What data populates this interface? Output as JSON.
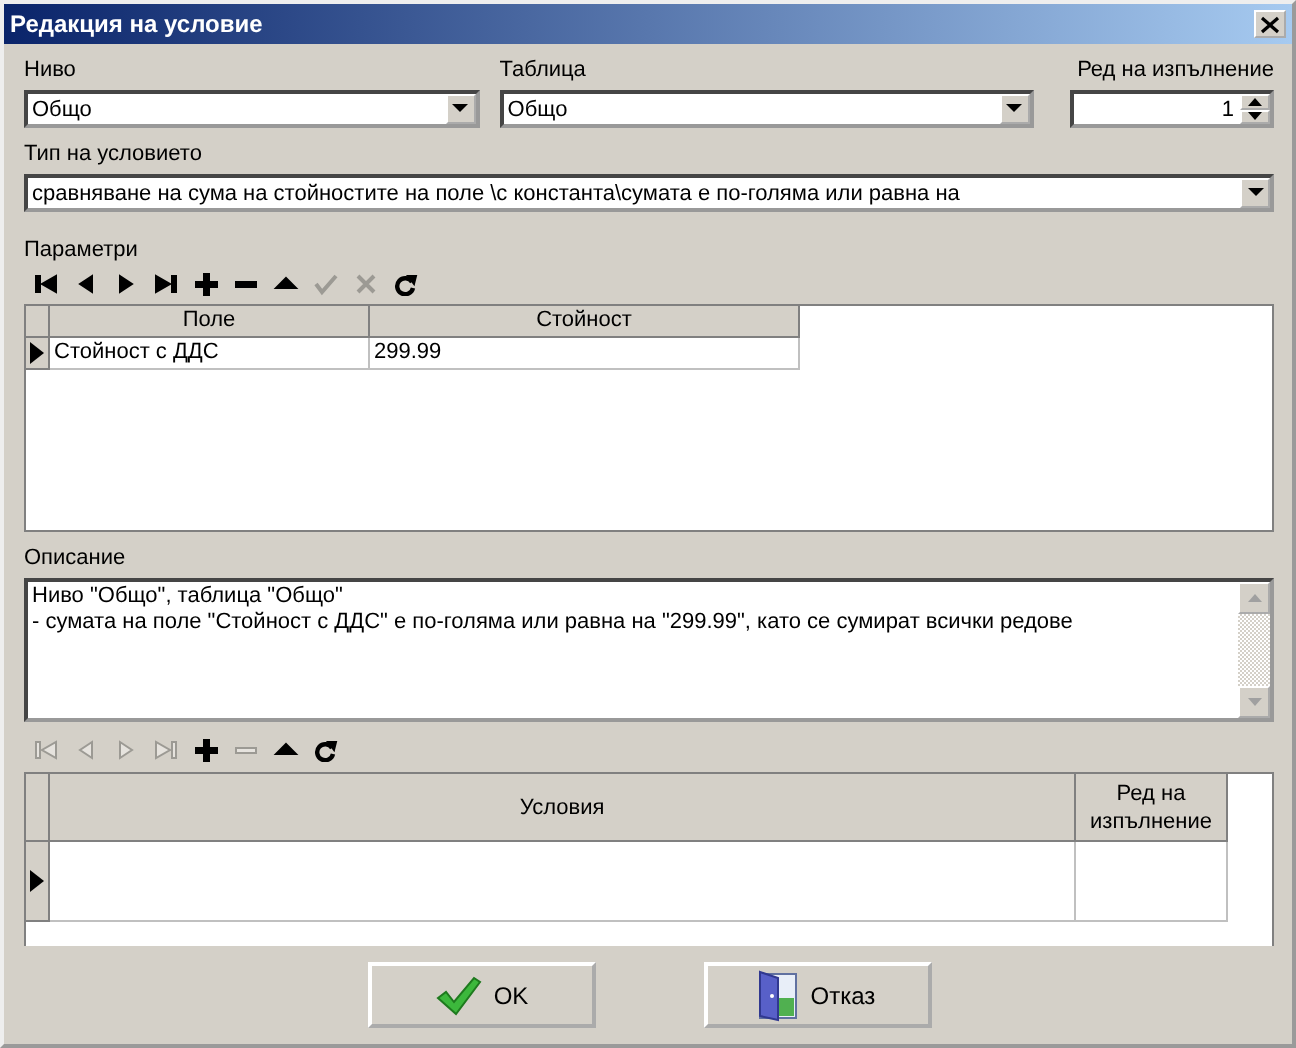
{
  "window": {
    "title": "Редакция на условие"
  },
  "level": {
    "label": "Ниво",
    "value": "Общо"
  },
  "table": {
    "label": "Таблица",
    "value": "Общо"
  },
  "order": {
    "label": "Ред на изпълнение",
    "value": "1"
  },
  "condition_type": {
    "label": "Тип на условието",
    "value": "сравняване на сума на стойностите на поле \\с константа\\сумата е по-голяма или равна на"
  },
  "parameters": {
    "label": "Параметри",
    "toolbar": [
      {
        "kind": "first",
        "disabled": false
      },
      {
        "kind": "prev",
        "disabled": false
      },
      {
        "kind": "next",
        "disabled": false
      },
      {
        "kind": "last",
        "disabled": false
      },
      {
        "kind": "add",
        "disabled": false
      },
      {
        "kind": "remove",
        "disabled": false
      },
      {
        "kind": "up",
        "disabled": false
      },
      {
        "kind": "check",
        "disabled": true
      },
      {
        "kind": "cancel",
        "disabled": true
      },
      {
        "kind": "refresh",
        "disabled": false
      }
    ],
    "columns": [
      "Поле",
      "Стойност"
    ],
    "rows": [
      {
        "cells": [
          "Стойност с ДДС",
          "299.99"
        ],
        "current": true
      }
    ]
  },
  "description": {
    "label": "Описание",
    "text": "Ниво \"Общо\", таблица \"Общо\"\n- сумата на поле \"Стойност с ДДС\" е по-голяма или равна на \"299.99\", като се сумират всички редове"
  },
  "conditions": {
    "toolbar": [
      {
        "kind": "first",
        "disabled": true
      },
      {
        "kind": "prev",
        "disabled": true
      },
      {
        "kind": "next",
        "disabled": true
      },
      {
        "kind": "last",
        "disabled": true
      },
      {
        "kind": "add",
        "disabled": false
      },
      {
        "kind": "remove",
        "disabled": true
      },
      {
        "kind": "up",
        "disabled": false
      },
      {
        "kind": "refresh",
        "disabled": false
      }
    ],
    "columns": [
      "Условия",
      "Ред на изпълнение"
    ],
    "rows": [
      {
        "current": true
      }
    ]
  },
  "buttons": [
    {
      "kind": "ok",
      "label": "OK"
    },
    {
      "kind": "cancel",
      "label": "Отказ"
    }
  ]
}
